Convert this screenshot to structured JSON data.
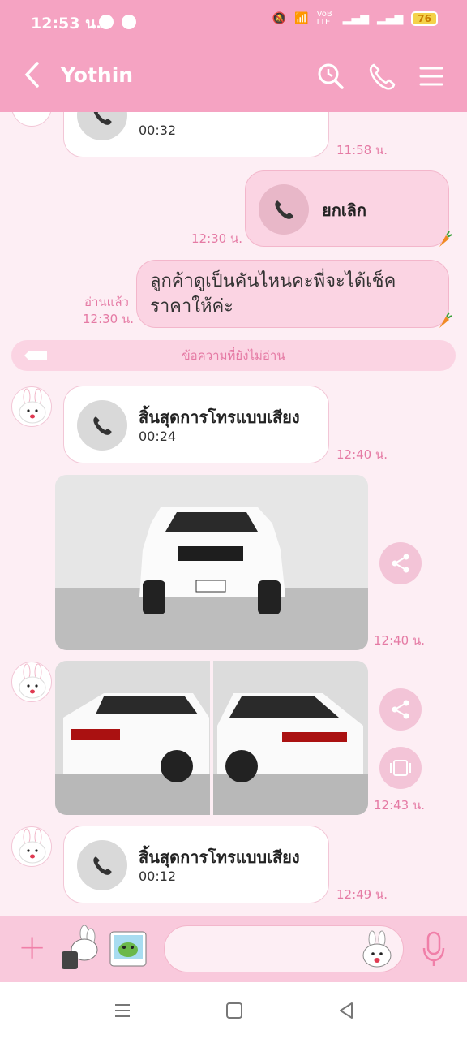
{
  "status_bar": {
    "time": "12:53 น.",
    "battery": "76",
    "net_label": "VoB LTE"
  },
  "header": {
    "title": "Yothin"
  },
  "messages": {
    "call_top": {
      "duration": "00:32",
      "time": "11:58 น."
    },
    "cancel_call": {
      "label": "ยกเลิก",
      "time": "12:30 น."
    },
    "text_msg": {
      "text": "ลูกค้าดูเป็นคันไหนคะพี่จะได้เช็คราคาให้ค่ะ",
      "read": "อ่านแล้ว",
      "time": "12:30 น."
    },
    "unread_divider": "ข้อความที่ยังไม่อ่าน",
    "call_1": {
      "title": "สิ้นสุดการโทรแบบเสียง",
      "duration": "00:24",
      "time": "12:40 น."
    },
    "photo_1": {
      "time": "12:40 น."
    },
    "photo_2": {
      "time": "12:43 น."
    },
    "call_2": {
      "title": "สิ้นสุดการโทรแบบเสียง",
      "duration": "00:12",
      "time": "12:49 น."
    }
  },
  "icons": {
    "header": [
      "back-icon",
      "search-icon",
      "phone-icon",
      "menu-icon"
    ],
    "input": [
      "plus-icon",
      "sticker-icon",
      "photo-sticker-icon",
      "emoji-icon",
      "mic-icon"
    ]
  },
  "colors": {
    "header_bg": "#f5a3c2",
    "chat_bg": "#fdeef4",
    "my_bubble": "#fbd4e3",
    "time_text": "#e57aa4"
  }
}
